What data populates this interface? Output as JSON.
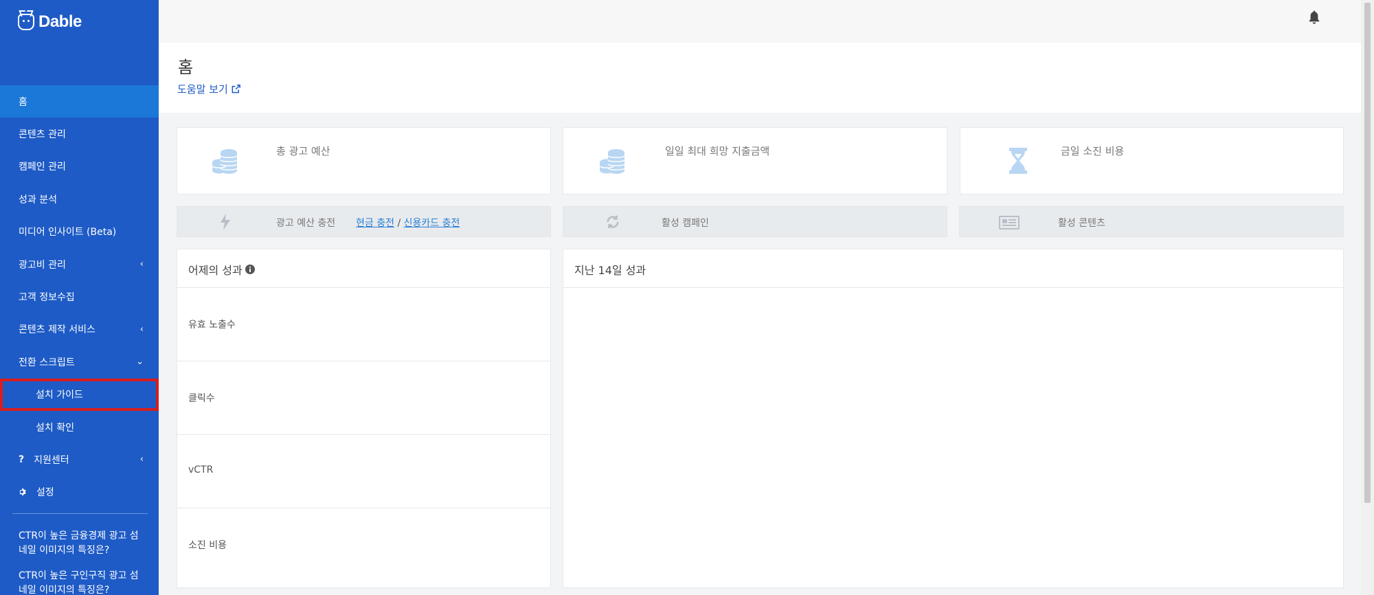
{
  "brand": {
    "name": "Dable"
  },
  "sidebar": {
    "items": [
      {
        "label": "홈",
        "active": true
      },
      {
        "label": "콘텐츠 관리"
      },
      {
        "label": "캠페인 관리"
      },
      {
        "label": "성과 분석"
      },
      {
        "label": "미디어 인사이트 (Beta)"
      },
      {
        "label": "광고비 관리",
        "chevron": "‹"
      },
      {
        "label": "고객 정보수집"
      },
      {
        "label": "콘텐츠 제작 서비스",
        "chevron": "‹"
      },
      {
        "label": "전환 스크립트",
        "chevron": "⌄"
      },
      {
        "label": "설치 가이드",
        "sub": true,
        "highlighted": true
      },
      {
        "label": "설치 확인",
        "sub": true
      },
      {
        "label": "지원센터",
        "icon": "?",
        "chevron": "‹"
      },
      {
        "label": "설정",
        "icon": "gear"
      }
    ],
    "promos": [
      "CTR이 높은 금융경제 광고 섬네일 이미지의 특징은?",
      "CTR이 높은 구인구직 광고 섬네일 이미지의 특징은?"
    ]
  },
  "header": {
    "title": "홈",
    "help_link": "도움말 보기"
  },
  "stats": {
    "total_budget_label": "총 광고 예산",
    "daily_max_label": "일일 최대 희망 지출금액",
    "today_spend_label": "금일 소진 비용"
  },
  "actions": {
    "charge_label": "광고 예산 충전",
    "cash_charge": "현금 충전",
    "separator": "/",
    "card_charge": "신용카드 충전",
    "active_campaigns": "활성 캠페인",
    "active_contents": "활성 콘텐츠"
  },
  "yesterday": {
    "title": "어제의 성과",
    "metrics": [
      "유효 노출수",
      "클릭수",
      "vCTR",
      "소진 비용"
    ]
  },
  "last14": {
    "title": "지난 14일 성과"
  },
  "colors": {
    "sidebar": "#1e5bc6",
    "sidebar_active": "#1b78d8",
    "highlight": "#d91e1e",
    "link": "#2a7fd1",
    "icon_light": "#b8d6f3"
  }
}
